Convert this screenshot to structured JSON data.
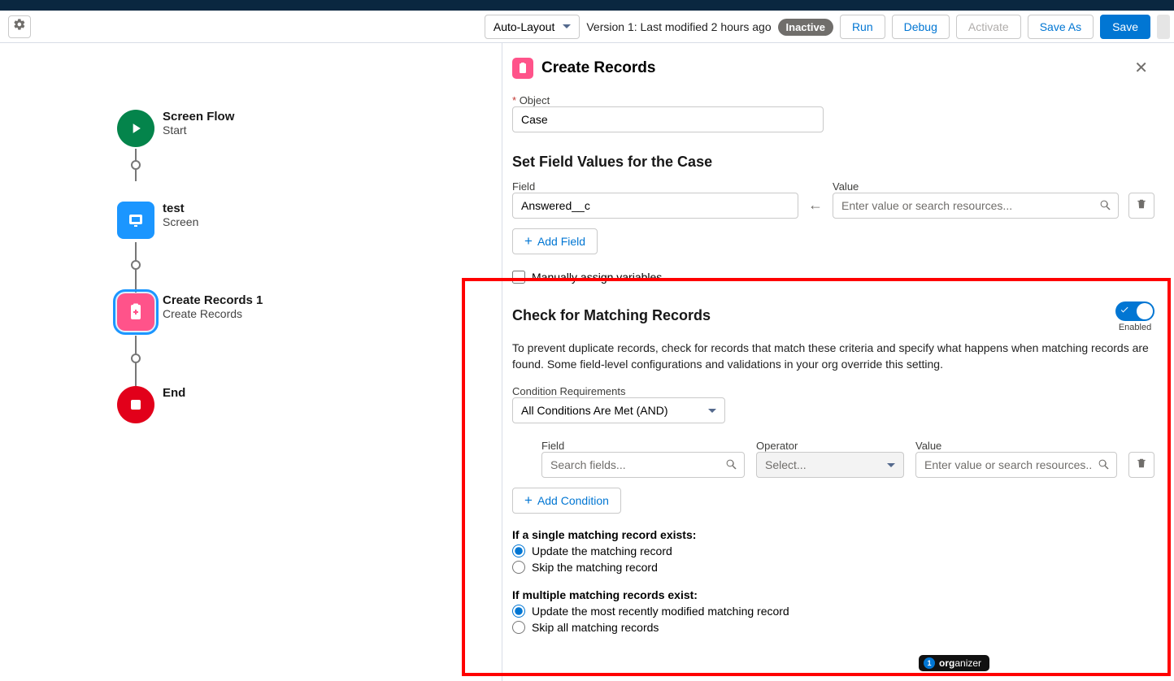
{
  "header": {
    "layout_label": "Auto-Layout",
    "version_text": "Version 1: Last modified 2 hours ago",
    "status_badge": "Inactive",
    "run": "Run",
    "debug": "Debug",
    "activate": "Activate",
    "save_as": "Save As",
    "save": "Save"
  },
  "canvas": {
    "n0": {
      "title": "Screen Flow",
      "sub": "Start"
    },
    "n1": {
      "title": "test",
      "sub": "Screen"
    },
    "n2": {
      "title": "Create Records 1",
      "sub": "Create Records"
    },
    "n3": {
      "title": "End"
    }
  },
  "panel": {
    "title": "Create Records",
    "object_label": "Object",
    "object_value": "Case",
    "set_values_heading": "Set Field Values for the Case",
    "field_label": "Field",
    "field_value": "Answered__c",
    "value_label": "Value",
    "value_placeholder": "Enter value or search resources...",
    "add_field": "Add Field",
    "manually_assign": "Manually assign variables",
    "check_heading": "Check for Matching Records",
    "toggle_state": "Enabled",
    "check_desc": "To prevent duplicate records, check for records that match these criteria and specify what happens when matching records are found. Some field-level configurations and validations in your org override this setting.",
    "cond_req_label": "Condition Requirements",
    "cond_req_value": "All Conditions Are Met (AND)",
    "cond_field_label": "Field",
    "cond_field_ph": "Search fields...",
    "cond_op_label": "Operator",
    "cond_op_ph": "Select...",
    "cond_val_label": "Value",
    "cond_val_ph": "Enter value or search resources..",
    "add_condition": "Add Condition",
    "single_heading": "If a single matching record exists:",
    "single_opt1": "Update the matching record",
    "single_opt2": "Skip the matching record",
    "multi_heading": "If multiple matching records exist:",
    "multi_opt1": "Update the most recently modified matching record",
    "multi_opt2": "Skip all matching records"
  },
  "footer": {
    "badge_bold": "org",
    "badge_rest": "anizer"
  }
}
